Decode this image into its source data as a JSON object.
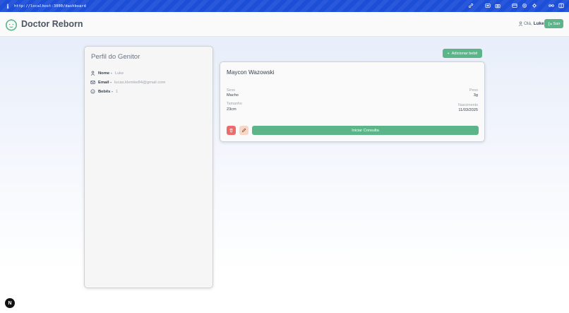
{
  "browser": {
    "url": "http://localhost:3000/dashboard",
    "info_icon": "i",
    "icons": [
      "link-icon",
      "screen-icon",
      "camera-icon",
      "window-icon",
      "settings-icon",
      "extension-icon",
      "glasses-icon",
      "sidebar-icon"
    ]
  },
  "header": {
    "brand": "Doctor Reborn",
    "greeting_prefix": "Olá,",
    "user_name": "Luke",
    "logout_label": "Sair"
  },
  "profile": {
    "title": "Perfil do Genitor",
    "rows": [
      {
        "icon": "user-icon",
        "label": "Nome -",
        "value": "Luke"
      },
      {
        "icon": "mail-icon",
        "label": "Email -",
        "value": "lucas.klemke84@gmail.com"
      },
      {
        "icon": "baby-icon",
        "label": "Bebês -",
        "value": "1"
      }
    ]
  },
  "actions": {
    "add_baby_label": "Adicionar bebê",
    "add_baby_icon": "+"
  },
  "baby": {
    "name": "Maycon Wazowski",
    "sex_label": "Sexo",
    "sex_value": "Macho",
    "weight_label": "Peso",
    "weight_value": "3g",
    "size_label": "Tamanho",
    "size_value": "23cm",
    "birth_label": "Nascimento",
    "birth_value": "11/03/2025",
    "consult_label": "Iniciar Consulta"
  },
  "dev": {
    "badge": "N"
  },
  "colors": {
    "primary": "#5cb589",
    "danger": "#ef6b6b",
    "edit": "#f6d7c8",
    "browser_bar": "#1d4ed8"
  }
}
